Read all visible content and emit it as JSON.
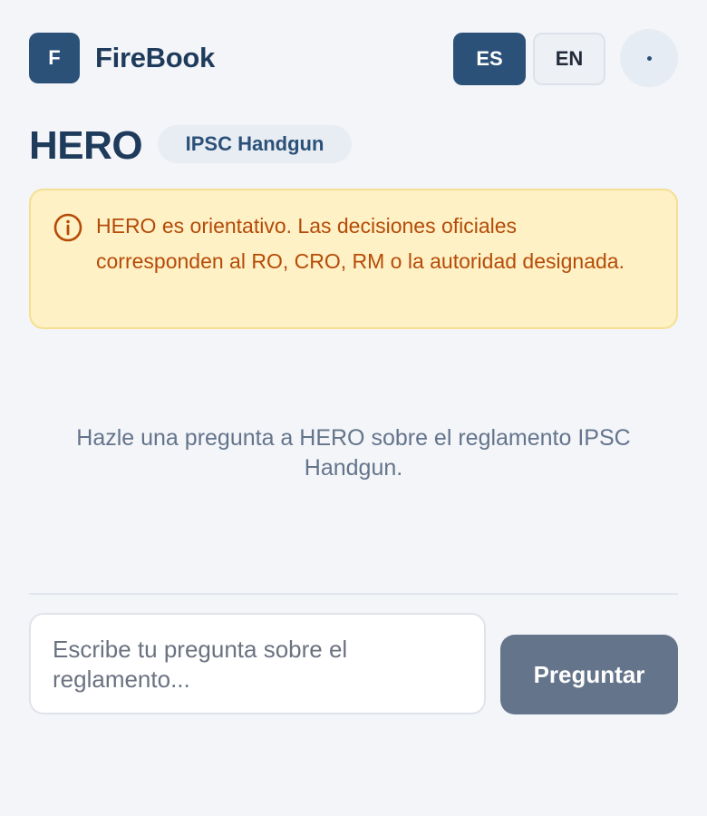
{
  "header": {
    "logo_letter": "F",
    "brand_name": "FireBook",
    "languages": [
      {
        "label": "ES",
        "active": true
      },
      {
        "label": "EN",
        "active": false
      }
    ]
  },
  "page": {
    "title": "HERO",
    "badge": "IPSC Handgun"
  },
  "notice": {
    "icon": "info-icon",
    "text": "HERO es orientativo. Las decisiones oficiales corresponden al RO, CRO, RM o la autoridad designada."
  },
  "chat": {
    "empty_message": "Hazle una pregunta a HERO sobre el reglamento IPSC Handgun."
  },
  "composer": {
    "value": "",
    "placeholder": "Escribe tu pregunta sobre el reglamento...",
    "submit_label": "Preguntar"
  },
  "colors": {
    "primary": "#2b5179",
    "background": "#f3f5f9",
    "warning_bg": "#fdf1c5",
    "warning_text": "#b64b08",
    "button_disabled": "#64748b"
  }
}
